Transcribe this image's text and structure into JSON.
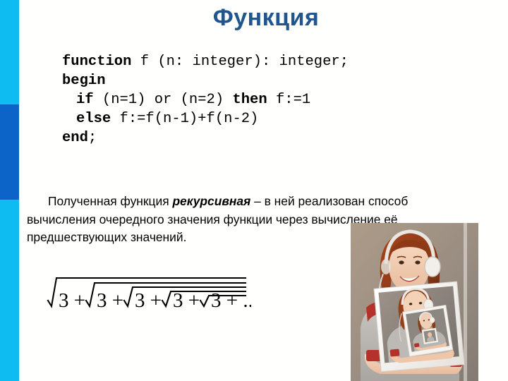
{
  "slide": {
    "title": "Функция",
    "title_color": "#21558E",
    "background_color": "#FFFFFE"
  },
  "edge_bars": {
    "light_color": "#0FBCF2",
    "dark_color": "#0C64C8"
  },
  "code": {
    "language": "Pascal",
    "lines": [
      {
        "indent": 0,
        "segments": [
          {
            "text": "function",
            "bold": true
          },
          {
            "text": " f (n: integer): integer;",
            "bold": false
          }
        ]
      },
      {
        "indent": 0,
        "segments": [
          {
            "text": "begin",
            "bold": true
          }
        ]
      },
      {
        "indent": 1,
        "segments": [
          {
            "text": "if",
            "bold": true
          },
          {
            "text": " (n=1) or (n=2) ",
            "bold": false
          },
          {
            "text": "then",
            "bold": true
          },
          {
            "text": " f:=1",
            "bold": false
          }
        ]
      },
      {
        "indent": 1,
        "segments": [
          {
            "text": "else",
            "bold": true
          },
          {
            "text": " f:=f(n-1)+f(n-2)",
            "bold": false
          }
        ]
      },
      {
        "indent": 0,
        "segments": [
          {
            "text": "end",
            "bold": true
          },
          {
            "text": ";",
            "bold": false
          }
        ]
      }
    ]
  },
  "paragraph": {
    "part1": "Полученная функция ",
    "emphasis": "рекурсивная",
    "part2": " – в ней реализован способ вычисления очередного значения функции через вычисление её предшествующих значений."
  },
  "formula": {
    "latex_like": "√(3 + √(3 + √(3 + √(3 + √(3 + …)))))",
    "radicand": "3",
    "operator": "+",
    "ellipsis": "...",
    "depth": 5
  },
  "photo": {
    "caption": "Девушка в наушниках держит фотографию себя, держащей фотографию себя (эффект Дросте / рекурсия)",
    "recursion_levels": 3
  }
}
